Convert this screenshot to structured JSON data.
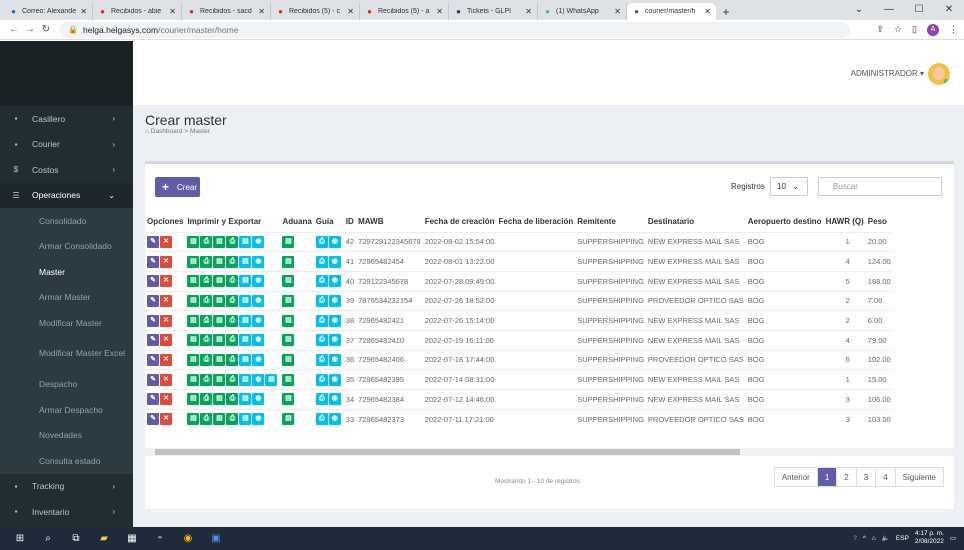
{
  "browser": {
    "tabs": [
      {
        "label": "Correo: Alexande",
        "icon": "outlook-icon",
        "color": "#0078d4"
      },
      {
        "label": "Recibidos - abie",
        "icon": "gmail-icon",
        "color": "#d93025"
      },
      {
        "label": "Recibidos - sacd",
        "icon": "gmail-icon",
        "color": "#d93025"
      },
      {
        "label": "Recibidos (5) - c",
        "icon": "gmail-icon",
        "color": "#d93025"
      },
      {
        "label": "Recibidos (5) - a",
        "icon": "gmail-icon",
        "color": "#d93025"
      },
      {
        "label": "Tickets - GLPI",
        "icon": "glpi-icon",
        "color": "#2c3e50"
      },
      {
        "label": "(1) WhatsApp",
        "icon": "whatsapp-icon",
        "color": "#25d366"
      },
      {
        "label": "courier/master/h",
        "icon": "globe-icon",
        "color": "#555555",
        "active": true
      }
    ],
    "url_host": "helga.helgasys.com",
    "url_path": "/courier/master/home"
  },
  "header": {
    "user": "ADMINISTRADOR ▾"
  },
  "sidebar": {
    "items": [
      {
        "label": "Casillero",
        "icon": "box-icon"
      },
      {
        "label": "Courier",
        "icon": "box-icon"
      },
      {
        "label": "Costos",
        "icon": "dollar-icon"
      },
      {
        "label": "Operaciones",
        "icon": "list-icon"
      }
    ],
    "sub": [
      "Consolidado",
      "Armar Consolidado",
      "Master",
      "Armar Master",
      "Modificar Master",
      "Modificar Master Excel",
      "Despacho",
      "Armar Despacho",
      "Novedades",
      "Consulta estado"
    ],
    "bottom": [
      {
        "label": "Tracking",
        "icon": "box-icon"
      },
      {
        "label": "Inventario",
        "icon": "box-icon"
      }
    ]
  },
  "page": {
    "title": "Crear master",
    "breadcrumb_home": "Dashboard",
    "breadcrumb_current": "Master"
  },
  "toolbar": {
    "crear": "Crear",
    "registros_label": "Registros",
    "registros_value": "10",
    "search_placeholder": "Buscar"
  },
  "table": {
    "headers": [
      "Opciones",
      "Imprimir y Exportar",
      "Aduana",
      "Guía",
      "ID",
      "MAWB",
      "Fecha de creación",
      "Fecha de liberación",
      "Remitente",
      "Destinatario",
      "Aeropuerto destino",
      "HAWR (Q)",
      "Peso"
    ],
    "rows": [
      {
        "id": "42",
        "mawb": "729729122345678",
        "fecha": "2022-08-02 15:54:00",
        "lib": "",
        "rem": "SUPPERSHIPPING",
        "dest": "NEW EXPRESS MAIL SAS",
        "aer": "BOG",
        "hawr": "1",
        "peso": "20.00"
      },
      {
        "id": "41",
        "mawb": "72965482454",
        "fecha": "2022-08-01 13:22:00",
        "lib": "",
        "rem": "SUPPERSHIPPING",
        "dest": "NEW EXPRESS MAIL SAS",
        "aer": "BOG",
        "hawr": "4",
        "peso": "124.00"
      },
      {
        "id": "40",
        "mawb": "729122345678",
        "fecha": "2022-07-28 09:49:00",
        "lib": "",
        "rem": "SUPPERSHIPPING",
        "dest": "NEW EXPRESS MAIL SAS",
        "aer": "BOG",
        "hawr": "5",
        "peso": "168.00"
      },
      {
        "id": "39",
        "mawb": "7876534232154",
        "fecha": "2022-07-26 18:52:00",
        "lib": "",
        "rem": "SUPPERSHIPPING",
        "dest": "PROVEEDOR OPTICO SAS",
        "aer": "BOG",
        "hawr": "2",
        "peso": "7.00"
      },
      {
        "id": "38",
        "mawb": "72965482421",
        "fecha": "2022-07-26 15:14:00",
        "lib": "",
        "rem": "SUPPERSHIPPING",
        "dest": "NEW EXPRESS MAIL SAS",
        "aer": "BOG",
        "hawr": "2",
        "peso": "6.00"
      },
      {
        "id": "37",
        "mawb": "72965482410",
        "fecha": "2022-07-19 16:11:00",
        "lib": "",
        "rem": "SUPPERSHIPPING",
        "dest": "NEW EXPRESS MAIL SAS",
        "aer": "BOG",
        "hawr": "4",
        "peso": "79.00"
      },
      {
        "id": "36",
        "mawb": "72965482406",
        "fecha": "2022-07-18 17:44:00",
        "lib": "",
        "rem": "SUPPERSHIPPING",
        "dest": "PROVEEDOR OPTICO SAS",
        "aer": "BOG",
        "hawr": "6",
        "peso": "102.00"
      },
      {
        "id": "35",
        "mawb": "72965482395",
        "fecha": "2022-07-14 08:31:00",
        "lib": "",
        "rem": "SUPPERSHIPPING",
        "dest": "NEW EXPRESS MAIL SAS",
        "aer": "BOG",
        "hawr": "1",
        "peso": "15.00",
        "extra": true
      },
      {
        "id": "34",
        "mawb": "72965482384",
        "fecha": "2022-07-12 14:46:00",
        "lib": "",
        "rem": "SUPPERSHIPPING",
        "dest": "NEW EXPRESS MAIL SAS",
        "aer": "BOG",
        "hawr": "3",
        "peso": "106.00"
      },
      {
        "id": "33",
        "mawb": "72965482373",
        "fecha": "2022-07-11 17:21:00",
        "lib": "",
        "rem": "SUPPERSHIPPING",
        "dest": "PROVEEDOR OPTICO SAS",
        "aer": "BOG",
        "hawr": "3",
        "peso": "103.00"
      }
    ]
  },
  "footer": {
    "info": "Mostrando 1 - 10 de registros",
    "prev": "Anterior",
    "pages": [
      "1",
      "2",
      "3",
      "4"
    ],
    "next": "Siguiente"
  },
  "taskbar": {
    "lang": "ESP",
    "time": "4:17 p. m.",
    "date": "2/08/2022"
  }
}
